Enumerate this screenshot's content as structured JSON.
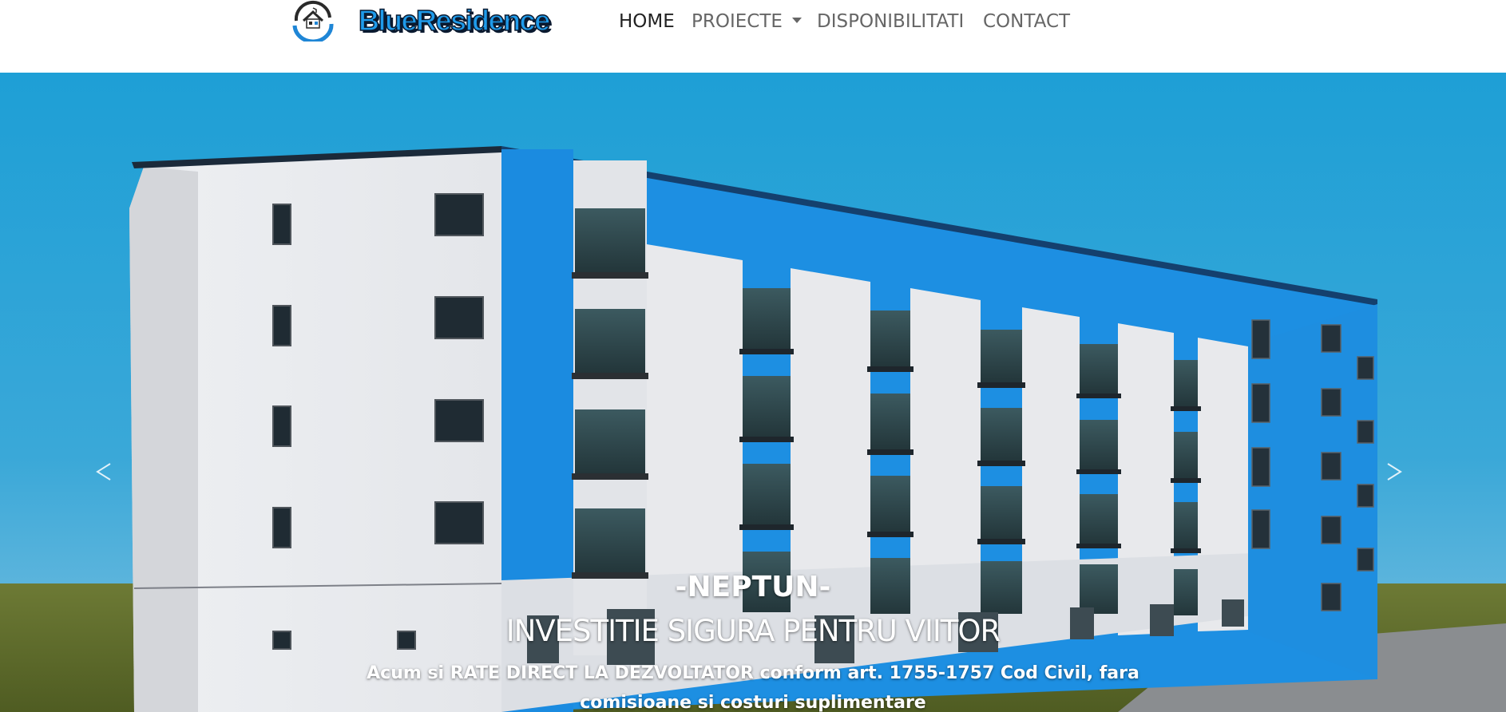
{
  "brand": {
    "name": "BlueResidence",
    "accent": "#1f9bea"
  },
  "nav": {
    "items": [
      {
        "label": "HOME",
        "active": true
      },
      {
        "label": "PROIECTE",
        "dropdown": true
      },
      {
        "label": "DISPONIBILITATI"
      },
      {
        "label": "CONTACT"
      }
    ]
  },
  "hero": {
    "title": "-NEPTUN-",
    "subtitle": "INVESTITIE SIGURA PENTRU VIITOR",
    "text": "Acum si RATE DIRECT LA DEZVOLTATOR conform art. 1755-1757 Cod Civil, fara comisioane si costuri suplimentare",
    "prev_icon": "chevron-left-icon",
    "next_icon": "chevron-right-icon",
    "colors": {
      "sky": "#27a3d8",
      "facade_blue": "#1d8fe2",
      "facade_white": "#ecedf0",
      "grass": "#5b6b2a"
    }
  }
}
